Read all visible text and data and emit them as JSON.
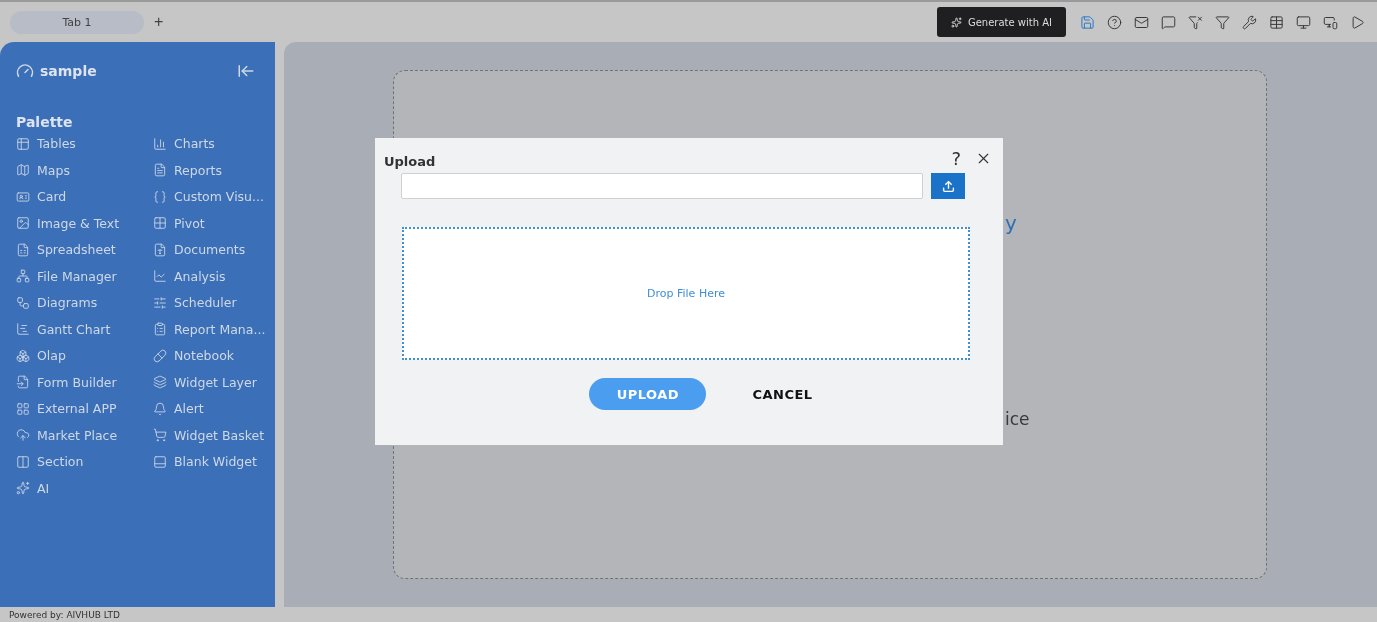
{
  "tabs": [
    {
      "label": "Tab 1",
      "selected": true
    }
  ],
  "add_tab": "+",
  "toolbar": {
    "generate_button": "Generate with AI"
  },
  "sidebar": {
    "title": "sample",
    "section": "Palette",
    "items": [
      {
        "label": "Tables"
      },
      {
        "label": "Charts"
      },
      {
        "label": "Maps"
      },
      {
        "label": "Reports"
      },
      {
        "label": "Card"
      },
      {
        "label": "Custom Visu..."
      },
      {
        "label": "Image & Text"
      },
      {
        "label": "Pivot"
      },
      {
        "label": "Spreadsheet"
      },
      {
        "label": "Documents"
      },
      {
        "label": "File Manager"
      },
      {
        "label": "Analysis"
      },
      {
        "label": "Diagrams"
      },
      {
        "label": "Scheduler"
      },
      {
        "label": "Gantt Chart"
      },
      {
        "label": "Report Mana..."
      },
      {
        "label": "Olap"
      },
      {
        "label": "Notebook"
      },
      {
        "label": "Form Builder"
      },
      {
        "label": "Widget Layer"
      },
      {
        "label": "External APP"
      },
      {
        "label": "Alert"
      },
      {
        "label": "Market Place"
      },
      {
        "label": "Widget Basket"
      },
      {
        "label": "Section"
      },
      {
        "label": "Blank Widget"
      },
      {
        "label": "AI"
      }
    ]
  },
  "canvas": {
    "fragments": [
      "y",
      "ice"
    ]
  },
  "dialog": {
    "title": "Upload",
    "help": "?",
    "drop_zone": "Drop File Here",
    "upload_button": "UPLOAD",
    "cancel_button": "CANCEL"
  },
  "footer": "Powered by: AIVHUB LTD"
}
